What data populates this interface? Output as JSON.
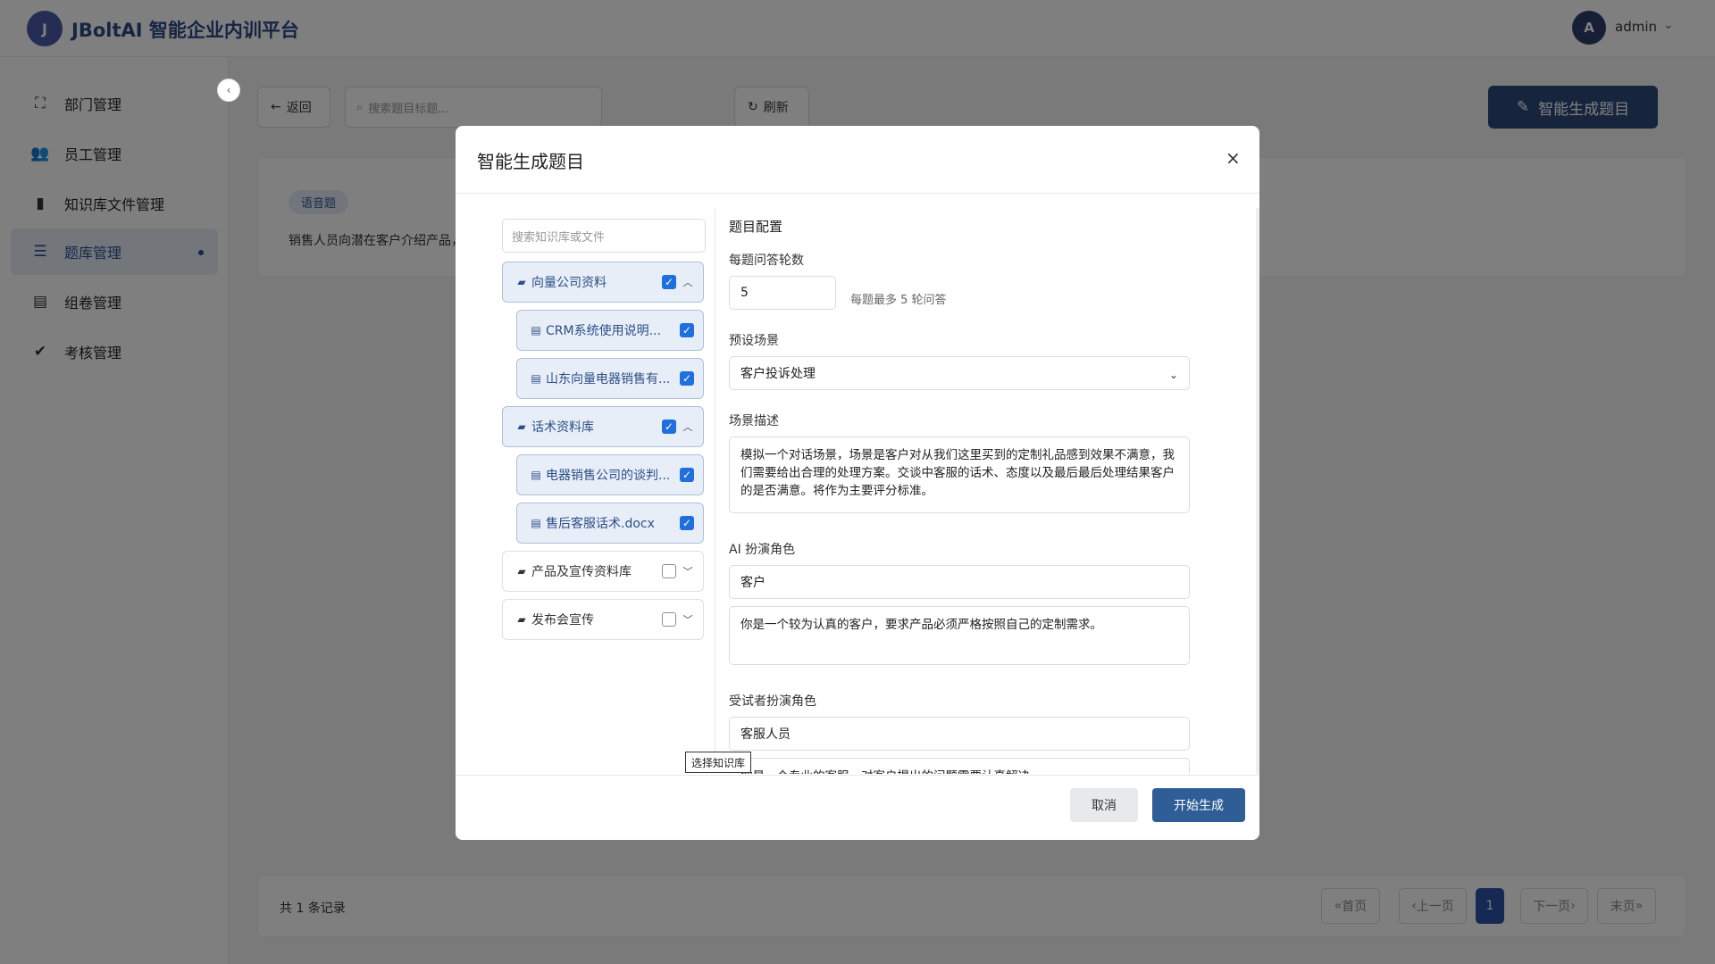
{
  "header": {
    "app_title": "JBoltAI 智能企业内训平台",
    "user_name": "admin",
    "icons": {
      "logo": "jbolt-logo",
      "avatar": "user-avatar",
      "dropdown": "chevron-down-icon"
    }
  },
  "sidebar": {
    "items": [
      {
        "label": "部门管理",
        "icon": "sitemap-icon"
      },
      {
        "label": "员工管理",
        "icon": "users-icon"
      },
      {
        "label": "知识库文件管理",
        "icon": "book-icon"
      },
      {
        "label": "题库管理",
        "icon": "list-check-icon",
        "active": true
      },
      {
        "label": "组卷管理",
        "icon": "file-icon"
      },
      {
        "label": "考核管理",
        "icon": "clipboard-check-icon"
      }
    ]
  },
  "toolbar": {
    "back_label": "返回",
    "search_placeholder": "搜索题目标题...",
    "refresh_label": "刷新",
    "generate_label": "智能生成题目"
  },
  "card": {
    "tag": "语音题",
    "text": "销售人员向潜在客户介绍产品，"
  },
  "footer": {
    "total": "共 1 条记录",
    "pager": {
      "first": "首页",
      "prev": "上一页",
      "current": "1",
      "next": "下一页",
      "last": "末页"
    }
  },
  "modal": {
    "title": "智能生成题目",
    "close": "×",
    "kb_search_placeholder": "搜索知识库或文件",
    "tree": [
      {
        "label": "向量公司资料",
        "type": "folder",
        "checked": true,
        "expanded": true
      },
      {
        "label": "CRM系统使用说明...",
        "type": "file",
        "checked": true
      },
      {
        "label": "山东向量电器销售有...",
        "type": "file",
        "checked": true
      },
      {
        "label": "话术资料库",
        "type": "folder",
        "checked": true,
        "expanded": true
      },
      {
        "label": "电器销售公司的谈判...",
        "type": "file",
        "checked": true
      },
      {
        "label": "售后客服话术.docx",
        "type": "file",
        "checked": true
      },
      {
        "label": "产品及宣传资料库",
        "type": "folder",
        "checked": false,
        "expanded": false
      },
      {
        "label": "发布会宣传",
        "type": "folder",
        "checked": false,
        "expanded": false
      }
    ],
    "tooltip": "选择知识库",
    "config": {
      "title": "题目配置",
      "rounds_label": "每题问答轮数",
      "rounds_value": "5",
      "rounds_hint": "每题最多 5 轮问答",
      "scene_label": "预设场景",
      "scene_value": "客户投诉处理",
      "desc_label": "场景描述",
      "desc_value": "模拟一个对话场景，场景是客户对从我们这里买到的定制礼品感到效果不满意，我们需要给出合理的处理方案。交谈中客服的话术、态度以及最后最后处理结果客户的是否满意。将作为主要评分标准。",
      "ai_role_label": "AI 扮演角色",
      "ai_role_value": "客户",
      "ai_role_desc": "你是一个较为认真的客户，要求产品必须严格按照自己的定制需求。",
      "trainee_role_label": "受试者扮演角色",
      "trainee_role_value": "客服人员",
      "trainee_role_desc": "你是一个专业的客服，对客户提出的问题需要认真解决..."
    },
    "cancel_label": "取消",
    "start_label": "开始生成"
  }
}
